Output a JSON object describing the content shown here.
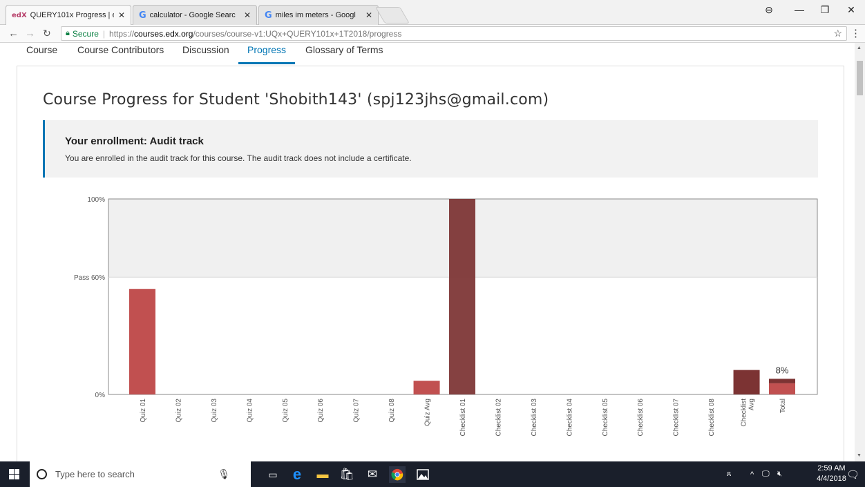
{
  "browser": {
    "tabs": [
      {
        "favicon": "edX",
        "title": "QUERY101x Progress | ec"
      },
      {
        "favicon": "G",
        "title": "calculator - Google Searc"
      },
      {
        "favicon": "G",
        "title": "miles im meters - Googl"
      }
    ],
    "secure_label": "Secure",
    "url_scheme": "https://",
    "url_host": "courses.edx.org",
    "url_path": "/courses/course-v1:UQx+QUERY101x+1T2018/progress"
  },
  "course_nav": {
    "items": [
      "Course",
      "Course Contributors",
      "Discussion",
      "Progress",
      "Glossary of Terms"
    ],
    "active": "Progress"
  },
  "page": {
    "heading": "Course Progress for Student 'Shobith143' (spj123jhs@gmail.com)",
    "enrollment_title": "Your enrollment: Audit track",
    "enrollment_text": "You are enrolled in the audit track for this course. The audit track does not include a certificate."
  },
  "chart_data": {
    "type": "bar",
    "y_ticks": [
      {
        "label": "100%",
        "value": 100
      },
      {
        "label": "Pass 60%",
        "value": 60
      },
      {
        "label": "0%",
        "value": 0
      }
    ],
    "ylim": [
      0,
      100
    ],
    "pass_value": 60,
    "categories": [
      "Quiz 01",
      "Quiz 02",
      "Quiz 03",
      "Quiz 04",
      "Quiz 05",
      "Quiz 06",
      "Quiz 07",
      "Quiz 08",
      "Quiz Avg",
      "Checklist 01",
      "Checklist 02",
      "Checklist 03",
      "Checklist 04",
      "Checklist 05",
      "Checklist 06",
      "Checklist 07",
      "Checklist 08",
      "Checklist Avg",
      "Total"
    ],
    "values": [
      54,
      0,
      0,
      0,
      0,
      0,
      0,
      0,
      7,
      100,
      0,
      0,
      0,
      0,
      0,
      0,
      0,
      12.5,
      8
    ],
    "bar_kind": [
      "quiz",
      "quiz",
      "quiz",
      "quiz",
      "quiz",
      "quiz",
      "quiz",
      "quiz",
      "quiz",
      "checklist",
      "checklist",
      "checklist",
      "checklist",
      "checklist",
      "checklist",
      "checklist",
      "checklist",
      "checklist",
      "total"
    ],
    "total_stack": {
      "quiz": 5.7,
      "checklist": 2.3
    },
    "total_label": "8%",
    "colors": {
      "quiz": "#c15050",
      "checklist": "#7c3333",
      "band": "#f0f0f0",
      "grid": "#d9d9d9"
    }
  },
  "taskbar": {
    "search_placeholder": "Type here to search",
    "time": "2:59 AM",
    "date": "4/4/2018"
  }
}
